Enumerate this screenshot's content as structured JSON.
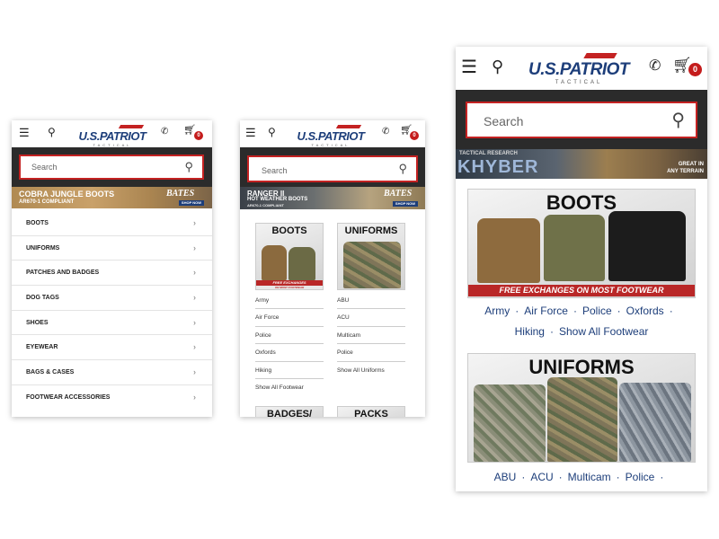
{
  "brand": {
    "name": "U.S.PATRIOT",
    "sub": "TACTICAL"
  },
  "header": {
    "cart_count": "0"
  },
  "search": {
    "placeholder": "Search"
  },
  "icons": {
    "menu": "hamburger-icon",
    "location": "map-pin-icon",
    "phone": "phone-icon",
    "cart": "cart-icon",
    "search": "magnifier-icon",
    "chevron": "chevron-right-icon"
  },
  "colors": {
    "brand_blue": "#1d3e7a",
    "accent_red": "#c42222",
    "search_bg": "#2b2b2b"
  },
  "phone1": {
    "banner": {
      "line1": "COBRA JUNGLE BOOTS",
      "line2": "AR670-1 COMPLIANT",
      "brand": "BATES",
      "shop": "SHOP NOW"
    },
    "menu": [
      "BOOTS",
      "UNIFORMS",
      "PATCHES AND BADGES",
      "DOG TAGS",
      "SHOES",
      "EYEWEAR",
      "BAGS & CASES",
      "FOOTWEAR ACCESSORIES"
    ]
  },
  "phone2": {
    "banner": {
      "line1": "RANGER II",
      "line2": "HOT WEATHER BOOTS",
      "line3": "AR670-1 COMPLIANT",
      "brand": "BATES",
      "shop": "SHOP NOW"
    },
    "boots": {
      "title": "BOOTS",
      "band": "FREE EXCHANGES",
      "band_sub": "ON MOST FOOTWEAR",
      "links": [
        "Army",
        "Air Force",
        "Police",
        "Oxfords",
        "Hiking",
        "Show All Footwear"
      ]
    },
    "uniforms": {
      "title": "UNIFORMS",
      "links": [
        "ABU",
        "ACU",
        "Multicam",
        "Police",
        "Show All Uniforms"
      ]
    },
    "badges_title": "BADGES/",
    "packs_title": "PACKS"
  },
  "phone3": {
    "banner": {
      "small": "TACTICAL RESEARCH",
      "big": "KHYBER",
      "right1": "GREAT IN",
      "right2": "ANY TERRAIN"
    },
    "boots": {
      "title": "BOOTS",
      "band": "FREE EXCHANGES ON MOST FOOTWEAR",
      "links_row1": [
        "Army",
        "Air Force",
        "Police",
        "Oxfords"
      ],
      "links_row2": [
        "Hiking",
        "Show All Footwear"
      ]
    },
    "uniforms": {
      "title": "UNIFORMS",
      "links": [
        "ABU",
        "ACU",
        "Multicam",
        "Police"
      ]
    }
  }
}
